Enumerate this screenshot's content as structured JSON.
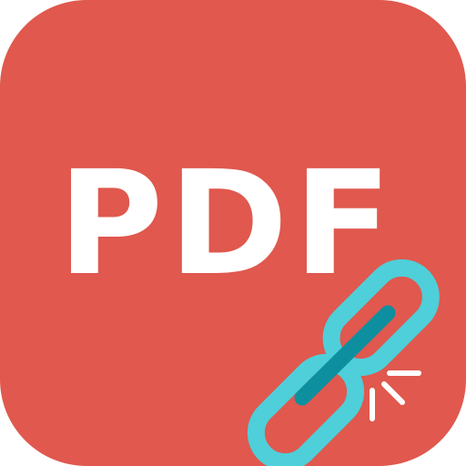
{
  "icon": {
    "label": "PDF",
    "colors": {
      "tile": "#E0584E",
      "label": "#FFFFFF",
      "chain_link": "#4ECFD9",
      "chain_bar": "#0E8FA0",
      "break_marks": "#FFFFFF"
    },
    "icon_names": [
      "pdf-app-icon",
      "chain-link-icon",
      "link-break-marks"
    ]
  }
}
